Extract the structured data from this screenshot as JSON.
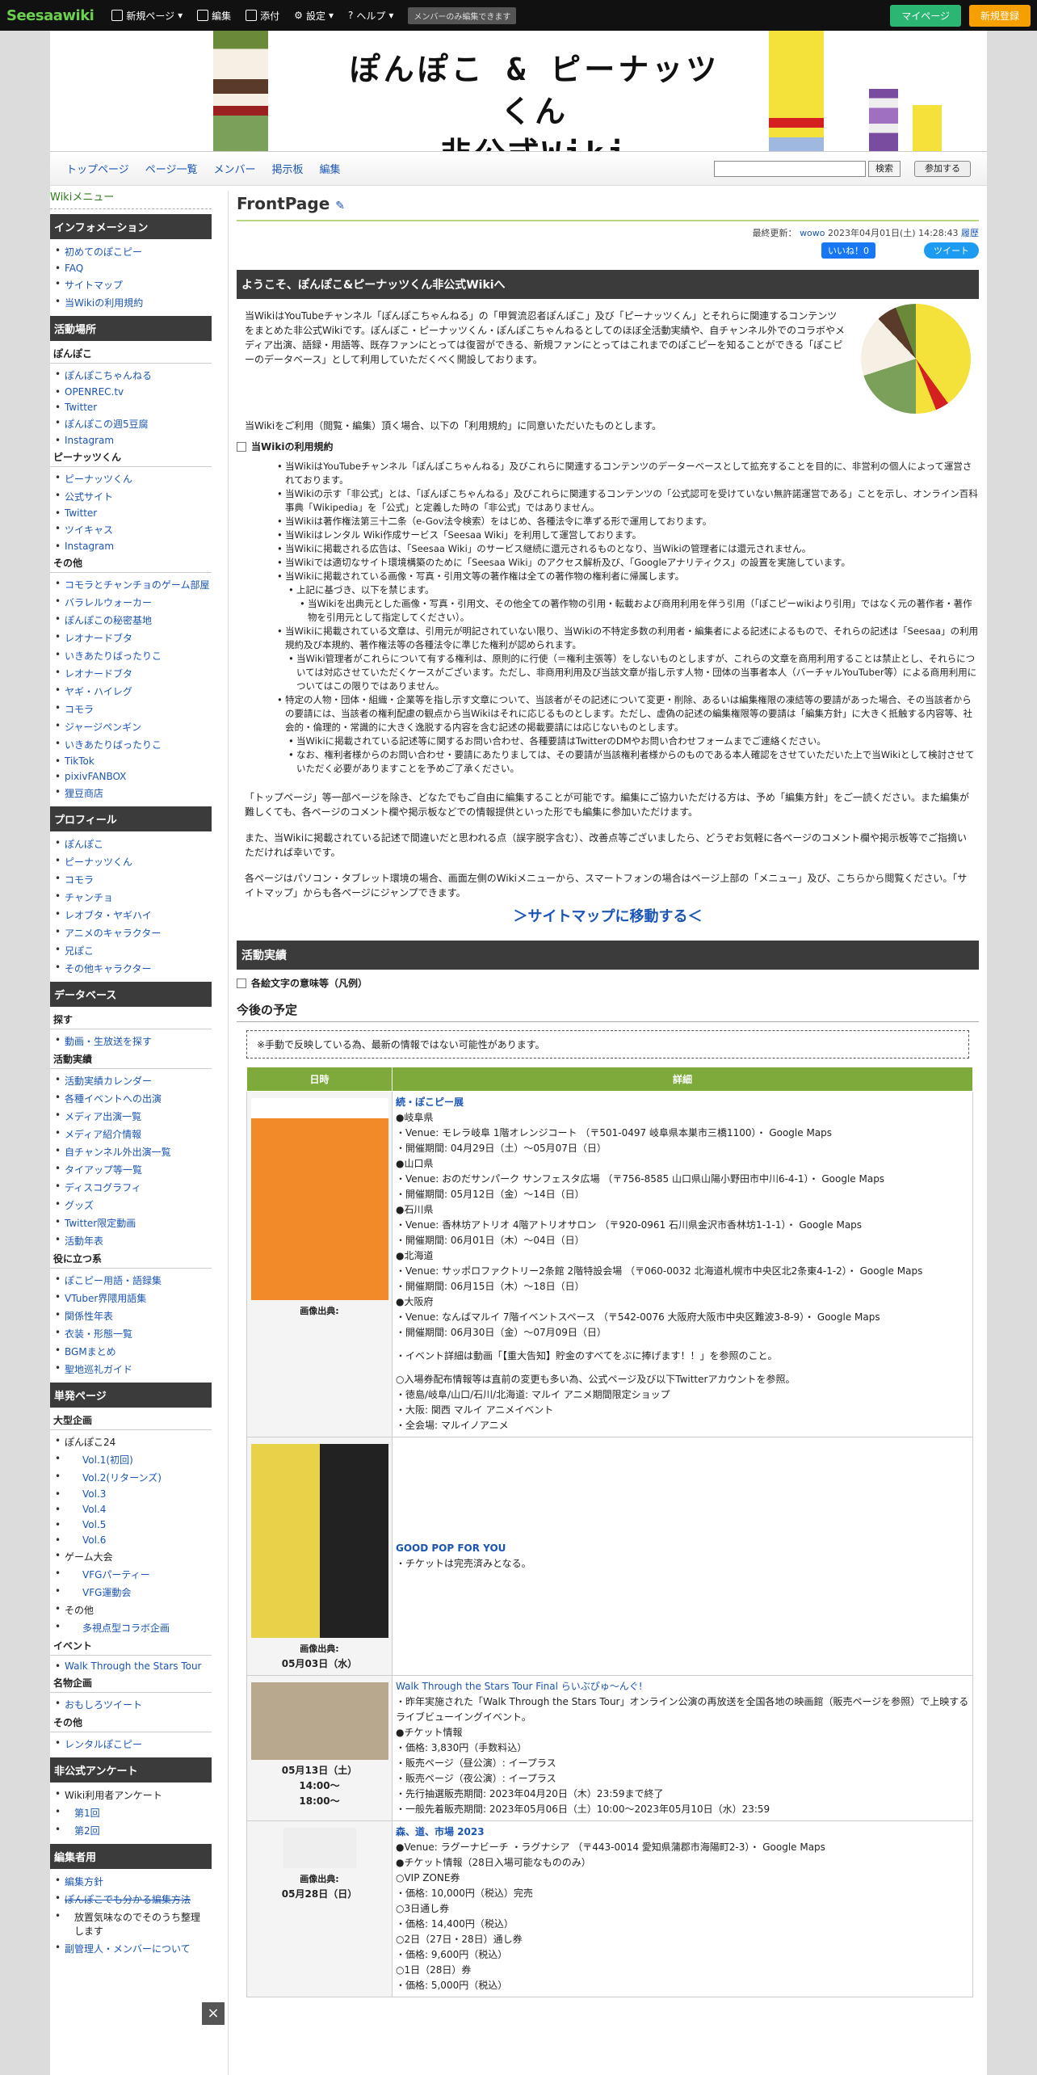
{
  "topbar": {
    "logo_a": "Seesaa",
    "logo_b": "wiki",
    "new_page": "新規ページ",
    "edit": "編集",
    "attach": "添付",
    "settings": "設定",
    "help": "ヘルプ",
    "notice": "メンバーのみ編集できます",
    "mypage": "マイページ",
    "signup": "新規登録"
  },
  "banner": {
    "title_line1": "ぽんぽこ & ピーナッツくん",
    "title_line2": "非公式Wiki"
  },
  "nav": {
    "items": [
      "トップページ",
      "ページ一覧",
      "メンバー",
      "掲示板",
      "編集"
    ],
    "search_button": "検索",
    "join_button": "参加する"
  },
  "side": {
    "header": "Wikiメニュー",
    "sec_info": "インフォメーション",
    "info": [
      "初めてのぽこピー",
      "FAQ",
      "サイトマップ",
      "当Wikiの利用規約"
    ],
    "sec_place": "活動場所",
    "ponpoko": "ぽんぽこ",
    "ponpoko_links": [
      "ぽんぽこちゃんねる",
      "OPENREC.tv",
      "Twitter",
      "ぽんぽこの週5豆腐",
      "Instagram"
    ],
    "peanuts": "ピーナッツくん",
    "peanuts_links": [
      "ピーナッツくん",
      "公式サイト",
      "Twitter",
      "ツイキャス",
      "Instagram"
    ],
    "other": "その他",
    "other_links": [
      "コモラとチャンチョのゲーム部屋",
      "バラレルウォーカー",
      "ぽんぽこの秘密基地",
      "レオナードブタ",
      "いきあたりばったりこ",
      "レオナードブタ",
      "ヤギ・ハイレグ",
      "コモラ",
      "ジャージペンギン",
      "いきあたりばったりこ",
      "TikTok",
      "pixivFANBOX",
      "狸豆商店"
    ],
    "sec_profile": "プロフィール",
    "profile": [
      "ぽんぽこ",
      "ピーナッツくん",
      "コモラ",
      "チャンチョ",
      "レオブタ・ヤギハイ",
      "アニメのキャラクター",
      "兄ぽこ",
      "その他キャラクター"
    ],
    "sec_db": "データベース",
    "db_sub": "探す",
    "db_find": [
      "動画・生放送を探す"
    ],
    "act_sub": "活動実績",
    "act": [
      "活動実績カレンダー",
      "各種イベントへの出演",
      "メディア出演一覧",
      "メディア紹介情報",
      "自チャンネル外出演一覧",
      "タイアップ等一覧",
      "ディスコグラフィ",
      "グッズ",
      "Twitter限定動画",
      "活動年表"
    ],
    "useful_sub": "役に立つ系",
    "useful": [
      "ぽこピー用語・語録集",
      "VTuber界隈用語集",
      "関係性年表",
      "衣装・形態一覧",
      "BGMまとめ",
      "聖地巡礼ガイド"
    ],
    "sec_single": "単発ページ",
    "big_sub": "大型企画",
    "big": [
      "ぽんぽこ24",
      "Vol.1(初回)",
      "Vol.2(リターンズ)",
      "Vol.3",
      "Vol.4",
      "Vol.5",
      "Vol.6",
      "ゲーム大会",
      "VFGパーティー",
      "VFG運動会",
      "その他",
      "多視点型コラボ企画"
    ],
    "event_sub": "イベント",
    "event": [
      "Walk Through the Stars Tour"
    ],
    "famous_sub": "名物企画",
    "famous": [
      "おもしろツイート"
    ],
    "others_sub": "その他",
    "others": [
      "レンタルぽこピー"
    ],
    "sec_survey": "非公式アンケート",
    "survey": [
      "Wiki利用者アンケート",
      "第1回",
      "第2回"
    ],
    "sec_editor": "編集者用",
    "editor": [
      "編集方針",
      "ぽんぽこでも分かる編集方法",
      "放置気味なのでそのうち整理します",
      "副管理人・メンバーについて"
    ]
  },
  "main": {
    "page_title": "FrontPage",
    "meta_label": "最終更新：",
    "meta_user": "wowo",
    "meta_date": "2023年04月01日(土) 14:28:43",
    "meta_history": "履歴",
    "fb": "いいね！0",
    "tw": "ツイート",
    "welcome_h": "ようこそ、ぽんぽこ&ピーナッツくん非公式Wikiへ",
    "intro": "当WikiはYouTubeチャンネル「ぽんぽこちゃんねる」の「甲賀流忍者ぽんぽこ」及び「ピーナッツくん」とそれらに関連するコンテンツをまとめた非公式Wikiです。ぽんぽこ・ピーナッツくん・ぽんぽこちゃんねるとしてのほぼ全活動実績や、自チャンネル外でのコラボやメディア出演、語録・用語等、既存ファンにとっては復習ができる、新規ファンにとってはこれまでのぽこピーを知ることができる「ぽこピーのデータベース」として利用していただくべく開設しております。",
    "agree": "当Wikiをご利用（閲覧・編集）頂く場合、以下の「利用規約」に同意いただいたものとします。",
    "terms_h": "当Wikiの利用規約",
    "terms": [
      "当WikiはYouTubeチャンネル「ぽんぽこちゃんねる」及びこれらに関連するコンテンツのデーターベースとして拡充することを目的に、非営利の個人によって運営されております。",
      "当Wikiの示す「非公式」とは、「ぽんぽこちゃんねる」及びこれらに関連するコンテンツの「公式認可を受けていない無許諾運営である」ことを示し、オンライン百科事典「Wikipedia」を「公式」と定義した時の「非公式」ではありません。",
      "当Wikiは著作権法第三十二条（e-Gov法令検索）をはじめ、各種法令に準ずる形で運用しております。",
      "当Wikiはレンタル Wiki作成サービス「Seesaa Wiki」を利用して運営しております。",
      "当Wikiに掲載される広告は、「Seesaa Wiki」のサービス継続に還元されるものとなり、当Wikiの管理者には還元されません。",
      "当Wikiでは適切なサイト環境構築のために「Seesaa Wiki」のアクセス解析及び、「Googleアナリティクス」の設置を実施しています。",
      "当Wikiに掲載されている画像・写真・引用文等の著作権は全ての著作物の権利者に帰属します。"
    ],
    "terms_sub": [
      "上記に基づき、以下を禁じます。",
      "当Wikiを出典元とした画像・写真・引用文、その他全ての著作物の引用・転載および商用利用を伴う引用（「ぽこピーwikiより引用」ではなく元の著作者・著作物を引用元として指定してください）。"
    ],
    "terms2": "当Wikiに掲載されている文章は、引用元が明記されていない限り、当Wikiの不特定多数の利用者・編集者による記述によるもので、それらの記述は「Seesaa」の利用規約及び本規約、著作権法等の各種法令に準じた権利が認められます。",
    "terms2_sub": "当Wiki管理者がこれらについて有する権利は、原則的に行使（＝権利主張等）をしないものとしますが、これらの文章を商用利用することは禁止とし、それらについては対応させていただくケースがございます。ただし、非商用利用及び当該文章が指し示す人物・団体の当事者本人（バーチャルYouTuber等）による商用利用についてはこの限りではありません。",
    "terms3": "特定の人物・団体・組織・企業等を指し示す文章について、当該者がその記述について変更・削除、あるいは編集権限の凍結等の要請があった場合、その当該者からの要請には、当該者の権利配慮の観点から当Wikiはそれに応じるものとします。ただし、虚偽の記述の編集権限等の要請は「編集方針」に大きく抵触する内容等、社会的・倫理的・常識的に大きく逸脱する内容を含む記述の掲載要請には応じないものとします。",
    "terms3_sub": [
      "当Wikiに掲載されている記述等に関するお問い合わせ、各種要請はTwitterのDMやお問い合わせフォームまでご連絡ください。",
      "なお、権利者様からのお問い合わせ・要請にあたりましては、その要請が当該権利者様からのものである本人確認をさせていただいた上で当Wikiとして検討させていただく必要がありますことを予めご了承ください。"
    ],
    "p1": "「トップページ」等一部ページを除き、どなたでもご自由に編集することが可能です。編集にご協力いただける方は、予め「編集方針」をご一読ください。また編集が難しくても、各ページのコメント欄や掲示板などでの情報提供といった形でも編集に参加いただけます。",
    "p2": "また、当Wikiに掲載されている記述で間違いだと思われる点（誤字脱字含む）、改善点等ございましたら、どうぞお気軽に各ページのコメント欄や掲示板等でご指摘いただければ幸いです。",
    "p3": "各ページはパソコン・タブレット環境の場合、画面左側のWikiメニューから、スマートフォンの場合はページ上部の「メニュー」及び、こちらから閲覧ください。「サイトマップ」からも各ページにジャンプできます。",
    "sitemap": "＞サイトマップに移動する＜",
    "activity_h": "活動実績",
    "meaning": "各絵文字の意味等（凡例）",
    "schedule_h": "今後の予定",
    "schedule_note": "※手動で反映している為、最新の情報ではない可能性があります。",
    "th_date": "日時",
    "th_detail": "詳細",
    "img_src": "画像出典:",
    "ev1_title": "続・ぽこピー展",
    "ev1_lines": [
      "●岐阜県",
      "・Venue: モレラ岐阜 1階オレンジコート （〒501-0497 岐阜県本巣市三橋1100）・ Google Maps",
      "・開催期間: 04月29日（土）～05月07日（日）",
      "●山口県",
      "・Venue: おのだサンパーク サンフェスタ広場 （〒756-8585 山口県山陽小野田市中川6-4-1）・ Google Maps",
      "・開催期間: 05月12日（金）～14日（日）",
      "●石川県",
      "・Venue: 香林坊アトリオ 4階アトリオサロン （〒920-0961 石川県金沢市香林坊1-1-1）・ Google Maps",
      "・開催期間: 06月01日（木）～04日（日）",
      "●北海道",
      "・Venue: サッポロファクトリー2条館 2階特設会場 （〒060-0032 北海道札幌市中央区北2条東4-1-2）・ Google Maps",
      "・開催期間: 06月15日（木）～18日（日）",
      "●大阪府",
      "・Venue: なんばマルイ 7階イベントスペース （〒542-0076 大阪府大阪市中央区難波3-8-9）・ Google Maps",
      "・開催期間: 06月30日（金）～07月09日（日）",
      "",
      "・イベント詳細は動画「【重大告知】貯金のすべてをぶに捧げます！！」を参照のこと。",
      "",
      "○入場券配布情報等は直前の変更も多い為、公式ページ及び以下Twitterアカウントを参照。",
      "・徳島/岐阜/山口/石川/北海道: マルイ アニメ期間限定ショップ",
      "・大阪: 関西 マルイ アニメイベント",
      "・全会場: マルイノアニメ"
    ],
    "ev2_title": "GOOD POP FOR YOU",
    "ev2_lines": [
      "・チケットは完売済みとなる。"
    ],
    "ev2_date": "05月03日（水）",
    "ev3_title": "Walk Through the Stars Tour Final らいぶぴゅ～んぐ!",
    "ev3_lines": [
      "・昨年実施された「Walk Through the Stars Tour」オンライン公演の再放送を全国各地の映画館（販売ページを参照）で上映するライブビューイングイベント。",
      "●チケット情報",
      "・価格: 3,830円（手数料込）",
      "・販売ページ（昼公演）: イープラス",
      "・販売ページ（夜公演）: イープラス",
      "・先行抽選販売期間: 2023年04月20日（木）23:59まで終了",
      "・一般先着販売期間: 2023年05月06日（土）10:00～2023年05月10日（水）23:59"
    ],
    "ev3_date": "05月13日（土）",
    "ev3_t1": "14:00～",
    "ev3_t2": "18:00～",
    "ev4_title": "森、道、市場 2023",
    "ev4_lines": [
      "●Venue: ラグーナビーチ ・ラグナシア （〒443-0014 愛知県蒲郡市海陽町2-3）・ Google Maps",
      "●チケット情報（28日入場可能なもののみ）",
      "○VIP ZONE券",
      "・価格: 10,000円（税込）完売",
      "○3日通し券",
      "・価格: 14,400円（税込）",
      "○2日（27日・28日）通し券",
      "・価格: 9,600円（税込）",
      "○1日（28日）券",
      "・価格: 5,000円（税込）"
    ],
    "ev4_date": "05月28日（日）"
  }
}
